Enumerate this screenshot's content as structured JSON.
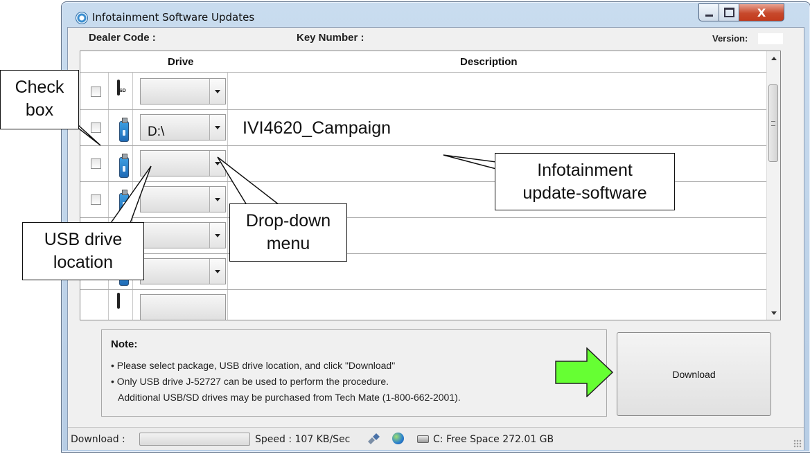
{
  "window": {
    "title": "Infotainment Software Updates",
    "close_glyph": "X"
  },
  "header": {
    "dealer_code_label": "Dealer Code :",
    "key_number_label": "Key Number :",
    "version_label": "Version:"
  },
  "grid": {
    "columns": [
      "",
      "",
      "Drive",
      "Description"
    ],
    "rows": [
      {
        "checked": false,
        "device": "sd-card-icon",
        "drive": "",
        "description": ""
      },
      {
        "checked": false,
        "device": "usb-drive-icon",
        "drive": "D:\\",
        "description": "IVI4620_Campaign"
      },
      {
        "checked": false,
        "device": "usb-drive-icon",
        "drive": "",
        "description": ""
      },
      {
        "checked": false,
        "device": "usb-drive-icon",
        "drive": "",
        "description": ""
      },
      {
        "checked": false,
        "device": "usb-drive-icon",
        "drive": "",
        "description": ""
      },
      {
        "checked": false,
        "device": "usb-drive-icon",
        "drive": "",
        "description": ""
      }
    ]
  },
  "note": {
    "title": "Note:",
    "lines": [
      "• Please select package, USB drive location, and click \"Download\"",
      "• Only USB drive J-52727 can be used to perform the procedure.",
      "Additional USB/SD drives may be purchased from Tech Mate (1-800-662-2001)."
    ]
  },
  "download_button": {
    "label": "Download"
  },
  "sd_icon_text": "SD",
  "status": {
    "download_label": "Download :",
    "download_progress": 0,
    "speed": "Speed : 107 KB/Sec",
    "free_space": "C: Free Space 272.01 GB"
  },
  "callouts": {
    "check_box": [
      "Check",
      "box"
    ],
    "usb_drive_location": [
      "USB drive",
      "location"
    ],
    "drop_down_menu": [
      "Drop-down",
      "menu"
    ],
    "infotainment_update": [
      "Infotainment",
      "update-software"
    ]
  },
  "colors": {
    "arrow_fill": "#66ff33",
    "close_button": "#c7492c",
    "window_frame": "#b7cde5"
  }
}
